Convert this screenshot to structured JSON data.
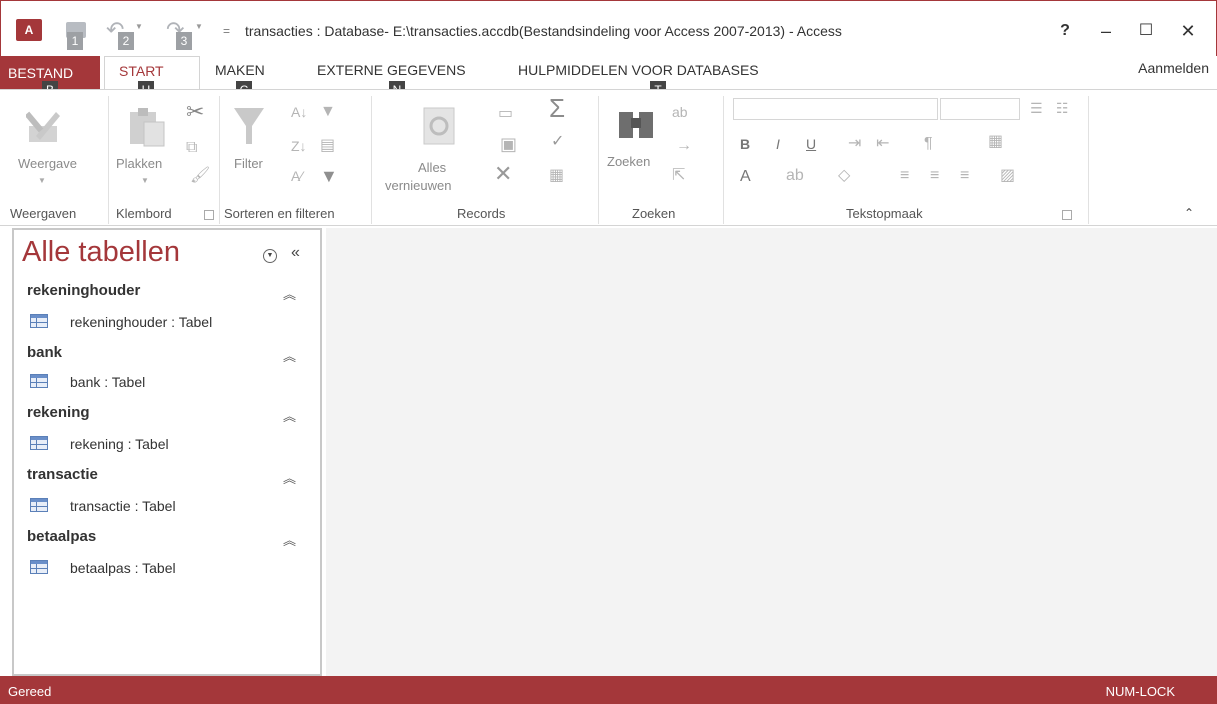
{
  "app": {
    "logo_text": "A",
    "window_title": "transacties : Database- E:\\transacties.accdb(Bestandsindeling voor Access 2007-2013) - Access",
    "help": "?",
    "minimize": "–",
    "maximize": "☐",
    "close": "✕",
    "qat_menu": "="
  },
  "keytips": {
    "qat1": "1",
    "qat2": "2",
    "qat3": "3",
    "file": "B",
    "home": "H",
    "create": "C",
    "external": "N",
    "tools": "T"
  },
  "tabs": {
    "file": "BESTAND",
    "start": "START",
    "create": "MAKEN",
    "external": "EXTERNE GEGEVENS",
    "tools": "HULPMIDDELEN VOOR DATABASES",
    "signin": "Aanmelden"
  },
  "ribbon": {
    "views": {
      "label": "Weergaven",
      "view_button": "Weergave"
    },
    "clipboard": {
      "label": "Klembord",
      "paste_button": "Plakken"
    },
    "sort_filter": {
      "label": "Sorteren en filteren",
      "filter_button": "Filter"
    },
    "records": {
      "label": "Records",
      "refresh_line1": "Alles",
      "refresh_line2": "vernieuwen"
    },
    "find": {
      "label": "Zoeken",
      "find_button": "Zoeken"
    },
    "text_format": {
      "label": "Tekstopmaak",
      "bold": "B",
      "italic": "I",
      "underline": "U",
      "font_color": "A"
    }
  },
  "nav_pane": {
    "title": "Alle tabellen",
    "groups": [
      {
        "header": "rekeninghouder",
        "item": "rekeninghouder : Tabel"
      },
      {
        "header": "bank",
        "item": "bank : Tabel"
      },
      {
        "header": "rekening",
        "item": "rekening : Tabel"
      },
      {
        "header": "transactie",
        "item": "transactie : Tabel"
      },
      {
        "header": "betaalpas",
        "item": "betaalpas : Tabel"
      }
    ]
  },
  "status": {
    "left": "Gereed",
    "right": "NUM-LOCK"
  },
  "colors": {
    "accent": "#a4373a",
    "workspace": "#f3f3f3"
  }
}
